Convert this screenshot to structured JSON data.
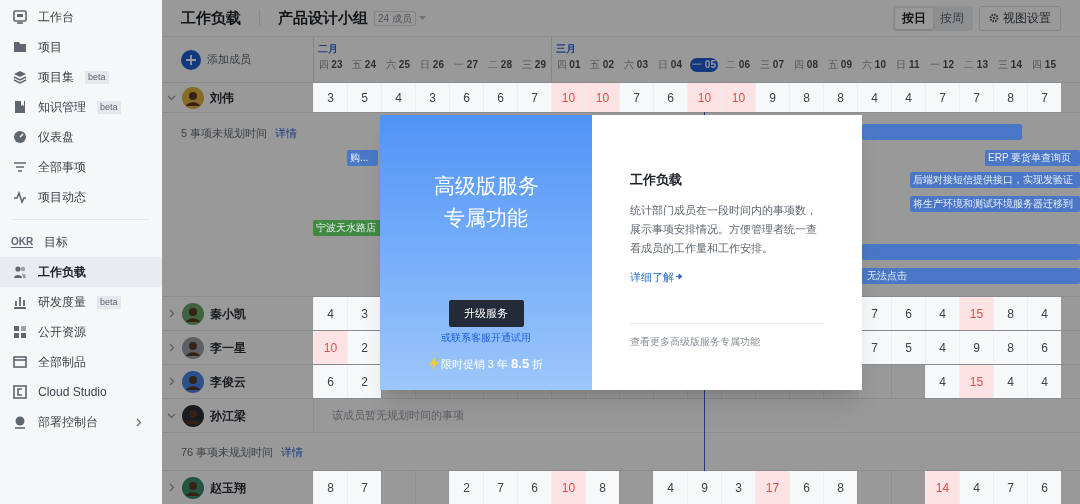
{
  "sidebar": {
    "groups": [
      [
        {
          "label": "工作台",
          "selected": false
        },
        {
          "label": "项目",
          "selected": false
        },
        {
          "label": "项目集",
          "badge": "beta",
          "selected": false
        },
        {
          "label": "知识管理",
          "badge": "beta",
          "selected": false
        },
        {
          "label": "仪表盘",
          "selected": false
        },
        {
          "label": "全部事项",
          "selected": false
        },
        {
          "label": "项目动态",
          "selected": false
        }
      ],
      [
        {
          "label": "目标",
          "icon_text": "OKR",
          "selected": false
        },
        {
          "label": "工作负载",
          "selected": true
        },
        {
          "label": "研发度量",
          "badge": "beta",
          "selected": false
        },
        {
          "label": "公开资源",
          "selected": false
        },
        {
          "label": "全部制品",
          "selected": false
        },
        {
          "label": "Cloud Studio",
          "selected": false
        },
        {
          "label": "部署控制台",
          "expandable": true,
          "selected": false
        }
      ]
    ]
  },
  "header": {
    "title": "工作负载",
    "team": "产品设计小组",
    "member_count": "24 成员",
    "view_modes": [
      {
        "label": "按日",
        "selected": true
      },
      {
        "label": "按周",
        "selected": false
      }
    ],
    "settings": "视图设置"
  },
  "timeline": {
    "add_member": "添加成员",
    "dates": [
      {
        "month": "二月",
        "weekday": "四",
        "day": "23",
        "today": false
      },
      {
        "weekday": "五",
        "day": "24",
        "today": false
      },
      {
        "weekday": "六",
        "day": "25",
        "today": false
      },
      {
        "weekday": "日",
        "day": "26",
        "today": false
      },
      {
        "weekday": "一",
        "day": "27",
        "today": false
      },
      {
        "weekday": "二",
        "day": "28",
        "today": false
      },
      {
        "weekday": "三",
        "day": "29",
        "today": false
      },
      {
        "month": "三月",
        "weekday": "四",
        "day": "01",
        "today": false
      },
      {
        "weekday": "五",
        "day": "02",
        "today": false
      },
      {
        "weekday": "六",
        "day": "03",
        "today": false
      },
      {
        "weekday": "日",
        "day": "04",
        "today": false
      },
      {
        "weekday": "一",
        "day": "05",
        "today": true
      },
      {
        "weekday": "二",
        "day": "06",
        "today": false
      },
      {
        "weekday": "三",
        "day": "07",
        "today": false
      },
      {
        "weekday": "四",
        "day": "08",
        "today": false
      },
      {
        "weekday": "五",
        "day": "09",
        "today": false
      },
      {
        "weekday": "六",
        "day": "10",
        "today": false
      },
      {
        "weekday": "日",
        "day": "11",
        "today": false
      },
      {
        "weekday": "一",
        "day": "12",
        "today": false
      },
      {
        "weekday": "二",
        "day": "13",
        "today": false
      },
      {
        "weekday": "三",
        "day": "14",
        "today": false
      },
      {
        "weekday": "四",
        "day": "15",
        "today": false
      }
    ]
  },
  "members": [
    {
      "name": "刘伟",
      "expanded": true,
      "cells": [
        {
          "value": "3",
          "overloaded": false
        },
        {
          "value": "5",
          "overloaded": false
        },
        {
          "value": "4",
          "overloaded": false
        },
        {
          "value": "3",
          "overloaded": false
        },
        {
          "value": "6",
          "overloaded": false
        },
        {
          "value": "6",
          "overloaded": false
        },
        {
          "value": "7",
          "overloaded": false
        },
        {
          "value": "10",
          "overloaded": true
        },
        {
          "value": "10",
          "overloaded": true
        },
        {
          "value": "7",
          "overloaded": false
        },
        {
          "value": "6",
          "overloaded": false
        },
        {
          "value": "10",
          "overloaded": true
        },
        {
          "value": "10",
          "overloaded": true
        },
        {
          "value": "9",
          "overloaded": false
        },
        {
          "value": "8",
          "overloaded": false
        },
        {
          "value": "8",
          "overloaded": false
        },
        {
          "value": "4",
          "overloaded": false
        },
        {
          "value": "4",
          "overloaded": false
        },
        {
          "value": "7",
          "overloaded": false
        },
        {
          "value": "7",
          "overloaded": false
        },
        {
          "value": "8",
          "overloaded": false
        },
        {
          "value": "7",
          "overloaded": false
        }
      ],
      "unplanned": {
        "count": "5 事项未规划时间",
        "link": "详情"
      },
      "tasks": [
        {
          "color": "#4a78c6"
        },
        {
          "label": "购...",
          "color": "#4a78c6"
        },
        {
          "label": "ERP 要货单查询页",
          "color": "#4a78c6"
        },
        {
          "label": "后端对接短信提供接口，实现发验证",
          "color": "#4a78c6"
        },
        {
          "label": "将生产环境和测试环境服务器迁移到",
          "color": "#4a78c6"
        },
        {
          "label": "宁波天水路店",
          "color": "#3f8a40"
        },
        {
          "color": "#4a78c6"
        },
        {
          "label": "无法点击",
          "color": "#4a78c6"
        }
      ]
    },
    {
      "name": "秦小凯",
      "expanded": false,
      "cells": [
        {
          "value": "4",
          "overloaded": false
        },
        {
          "value": "3",
          "overloaded": false
        },
        null,
        null,
        null,
        null,
        null,
        null,
        null,
        null,
        null,
        null,
        null,
        null,
        null,
        null,
        {
          "value": "7",
          "overloaded": false
        },
        {
          "value": "6",
          "overloaded": false
        },
        {
          "value": "4",
          "overloaded": false
        },
        {
          "value": "15",
          "overloaded": true
        },
        {
          "value": "8",
          "overloaded": false
        },
        {
          "value": "4",
          "overloaded": false
        }
      ]
    },
    {
      "name": "李一星",
      "expanded": false,
      "cells": [
        {
          "value": "10",
          "overloaded": true
        },
        {
          "value": "2",
          "overloaded": false
        },
        null,
        null,
        null,
        null,
        null,
        null,
        null,
        null,
        null,
        null,
        null,
        null,
        null,
        null,
        {
          "value": "7",
          "overloaded": false
        },
        {
          "value": "5",
          "overloaded": false
        },
        {
          "value": "4",
          "overloaded": false
        },
        {
          "value": "9",
          "overloaded": false
        },
        {
          "value": "8",
          "overloaded": false
        },
        {
          "value": "6",
          "overloaded": false
        }
      ]
    },
    {
      "name": "李俊云",
      "expanded": false,
      "cells": [
        {
          "value": "6",
          "overloaded": false
        },
        {
          "value": "2",
          "overloaded": false
        },
        null,
        null,
        null,
        null,
        null,
        null,
        null,
        null,
        null,
        null,
        null,
        null,
        null,
        null,
        null,
        null,
        {
          "value": "4",
          "overloaded": false
        },
        {
          "value": "15",
          "overloaded": true
        },
        {
          "value": "4",
          "overloaded": false
        },
        {
          "value": "4",
          "overloaded": false
        }
      ]
    },
    {
      "name": "孙江梁",
      "expanded": true,
      "empty_message": "该成员暂无规划时间的事项",
      "unplanned": {
        "count": "76 事项未规划时间",
        "link": "详情"
      }
    },
    {
      "name": "赵玉翔",
      "expanded": false,
      "cells": [
        {
          "value": "8",
          "overloaded": false
        },
        {
          "value": "7",
          "overloaded": false
        },
        null,
        null,
        {
          "value": "2",
          "overloaded": false
        },
        {
          "value": "7",
          "overloaded": false
        },
        {
          "value": "6",
          "overloaded": false
        },
        {
          "value": "10",
          "overloaded": true
        },
        {
          "value": "8",
          "overloaded": false
        },
        null,
        {
          "value": "4",
          "overloaded": false
        },
        {
          "value": "9",
          "overloaded": false
        },
        {
          "value": "3",
          "overloaded": false
        },
        {
          "value": "17",
          "overloaded": true
        },
        {
          "value": "6",
          "overloaded": false
        },
        {
          "value": "8",
          "overloaded": false
        },
        null,
        null,
        {
          "value": "14",
          "overloaded": true
        },
        {
          "value": "4",
          "overloaded": false
        },
        {
          "value": "7",
          "overloaded": false
        },
        {
          "value": "6",
          "overloaded": false
        }
      ]
    }
  ],
  "modal": {
    "headline": [
      "高级版服务",
      "专属功能"
    ],
    "upgrade_button": "升级服务",
    "contact_link": "或联系客服开通试用",
    "promo": "限时促销 3 年 **8.5** 折",
    "title": "工作负载",
    "description": "统计部门成员在一段时间内的事项数，展示事项安排情况。方便管理者统一查看成员的工作量和工作安排。",
    "learn_more": "详细了解",
    "more_features": "查看更多高级版服务专属功能"
  }
}
